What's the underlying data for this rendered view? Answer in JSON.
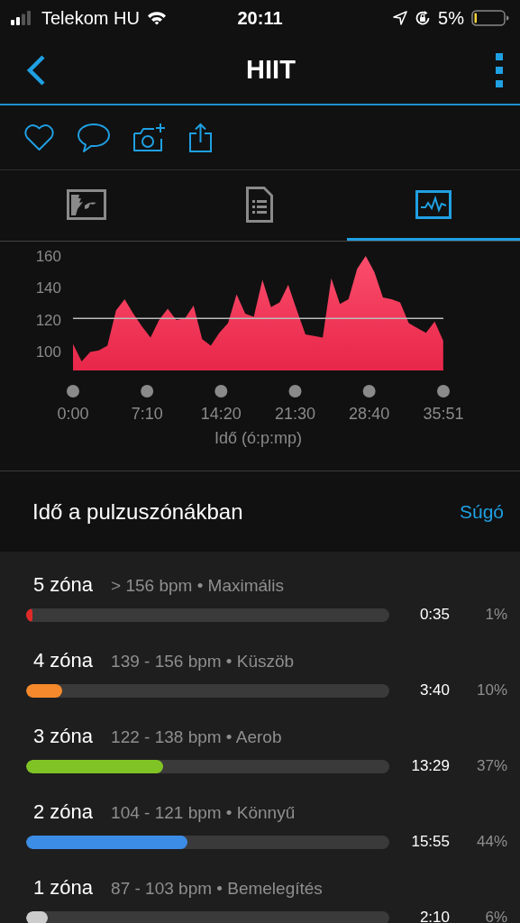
{
  "status_bar": {
    "carrier": "Telekom HU",
    "time": "20:11",
    "battery": "5%"
  },
  "header": {
    "title": "HIIT"
  },
  "tabs": [
    {
      "kind": "map",
      "selected": false
    },
    {
      "kind": "details",
      "selected": false
    },
    {
      "kind": "chart",
      "selected": true
    }
  ],
  "chart": {
    "chart_data": {
      "type": "area",
      "xlabel": "Idő (ó:p:mp)",
      "xlim": [
        0,
        2151
      ],
      "ylim": [
        89,
        160
      ],
      "yticks": [
        100,
        120,
        140,
        160
      ],
      "xticks": [
        {
          "value": 0,
          "label": "0:00"
        },
        {
          "value": 430,
          "label": "7:10"
        },
        {
          "value": 860,
          "label": "14:20"
        },
        {
          "value": 1290,
          "label": "21:30"
        },
        {
          "value": 1720,
          "label": "28:40"
        },
        {
          "value": 2151,
          "label": "35:51"
        }
      ],
      "x": [
        0,
        50,
        100,
        150,
        200,
        250,
        300,
        350,
        400,
        450,
        500,
        550,
        600,
        650,
        700,
        750,
        800,
        850,
        900,
        950,
        1000,
        1050,
        1100,
        1150,
        1200,
        1250,
        1300,
        1350,
        1400,
        1450,
        1500,
        1550,
        1600,
        1650,
        1700,
        1750,
        1800,
        1850,
        1900,
        1950,
        2000,
        2050,
        2100,
        2150
      ],
      "series": [
        {
          "color": "#e8274a",
          "values": [
            105,
            94,
            100,
            101,
            104,
            126,
            133,
            124,
            116,
            109,
            120,
            127,
            120,
            121,
            129,
            108,
            104,
            112,
            118,
            136,
            124,
            122,
            145,
            128,
            131,
            142,
            126,
            111,
            110,
            109,
            146,
            130,
            133,
            152,
            160,
            150,
            134,
            133,
            131,
            118,
            115,
            112,
            119,
            107
          ]
        }
      ],
      "ref_lines": [
        {
          "axis": "y",
          "value": 121
        }
      ]
    }
  },
  "zones_section": {
    "title": "Idő a pulzuszónákban",
    "help": "Súgó"
  },
  "zones": [
    {
      "name": "5 zóna",
      "range": "> 156 bpm • Maximális",
      "level": 0.016,
      "color": "#e02a2a",
      "time": "0:35",
      "percent": "1%"
    },
    {
      "name": "4 zóna",
      "range": "139 - 156 bpm • Küszöb",
      "level": 0.1,
      "color": "#f5892b",
      "time": "3:40",
      "percent": "10%"
    },
    {
      "name": "3 zóna",
      "range": "122 - 138 bpm • Aerob",
      "level": 0.377,
      "color": "#7fc424",
      "time": "13:29",
      "percent": "37%"
    },
    {
      "name": "2 zóna",
      "range": "104 - 121 bpm • Könnyű",
      "level": 0.443,
      "color": "#3b8de6",
      "time": "15:55",
      "percent": "44%"
    },
    {
      "name": "1 zóna",
      "range": "87 - 103 bpm • Bemelegítés",
      "level": 0.06,
      "color": "#cccccc",
      "time": "2:10",
      "percent": "6%"
    }
  ]
}
